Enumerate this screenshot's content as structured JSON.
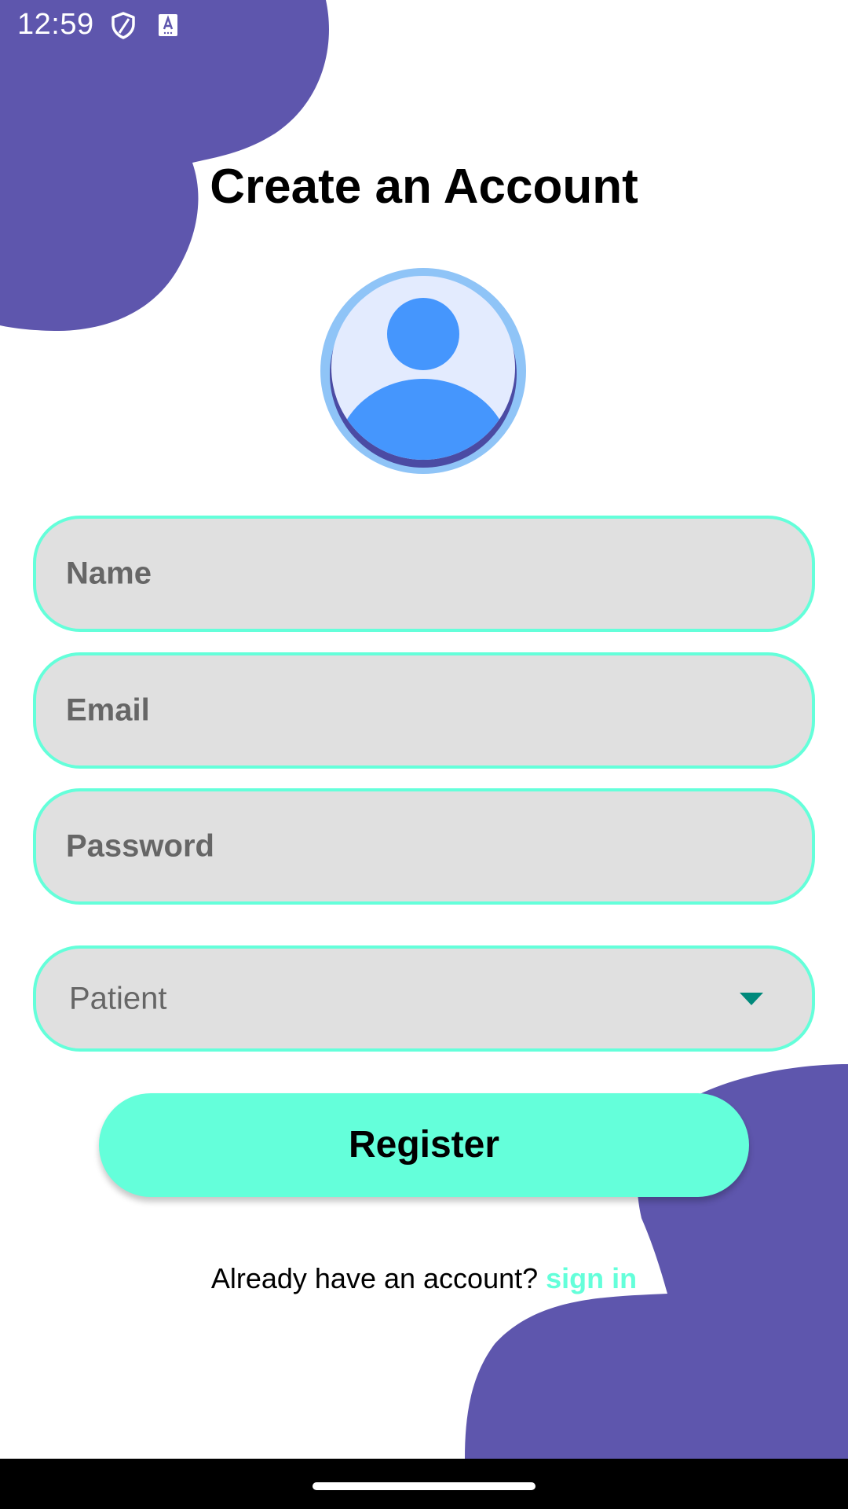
{
  "status_bar": {
    "time": "12:59",
    "icons": [
      "shield-icon",
      "keyboard-a-icon"
    ]
  },
  "page": {
    "title": "Create an Account",
    "avatar_icon": "person-avatar-icon"
  },
  "form": {
    "name_placeholder": "Name",
    "email_placeholder": "Email",
    "password_placeholder": "Password",
    "role_selected": "Patient",
    "role_arrow_icon": "dropdown-arrow-icon"
  },
  "actions": {
    "register_label": "Register",
    "signin_prompt": "Already have an account?",
    "signin_link": "sign in"
  },
  "colors": {
    "accent": "#64ffda",
    "blob": "#5e56ad",
    "field_bg": "#e0e0e0",
    "avatar_blue": "#4596fd",
    "arrow": "#00897b"
  }
}
